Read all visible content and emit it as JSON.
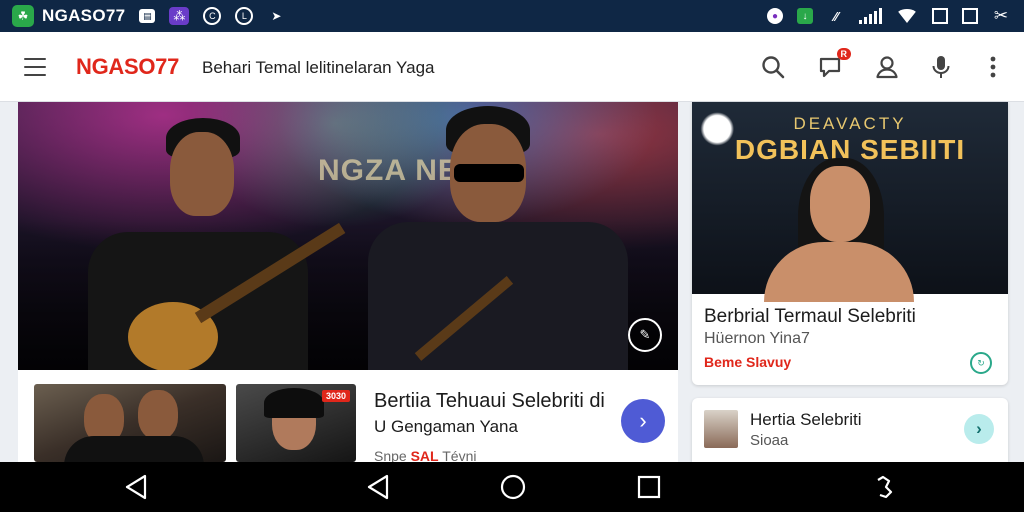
{
  "status_bar": {
    "app_name": "NGASO77",
    "left_icons": [
      "app-logo-icon",
      "keyboard-icon",
      "podcast-icon",
      "vpn-icon",
      "data-saver-icon",
      "arrow-icon"
    ],
    "right_icons": [
      "location-icon",
      "download-icon",
      "hd-icon",
      "signal-icon",
      "wifi-icon",
      "square-icon",
      "square-icon",
      "settings-icon"
    ]
  },
  "app_bar": {
    "brand": "NGASO77",
    "tagline": "Behari Temal lelitinelaran Yaga",
    "actions": [
      "search-icon",
      "notification-icon",
      "account-icon",
      "mic-icon",
      "more-vert-icon"
    ],
    "notification_badge": "R"
  },
  "main_article": {
    "hero_overlay_text": "NGZA NEI",
    "title": "Bertiia Tehuaui Selebriti di",
    "subtitle": "U Gengaman Yana",
    "meta_prefix": "Snpe",
    "meta_highlight": "SAL",
    "meta_suffix": "Tévni",
    "thumb_badge": "3030"
  },
  "side_card_1": {
    "kicker": "DEAVACTY",
    "headline": "DGBIAN SEBIITI",
    "title": "Berbrial Termaul Selebriti",
    "subtitle": "Hüernon Yina7",
    "meta": "Beme Slavuy"
  },
  "side_card_2": {
    "title": "Hertia Selebriti",
    "subtitle": "Sioaa"
  },
  "nav_bar": {
    "buttons": [
      "back-icon",
      "home-icon",
      "recents-icon"
    ]
  },
  "colors": {
    "accent_red": "#e0271b",
    "status_bar": "#0f2745",
    "fab_blue": "#4f5bd5",
    "teal": "#2aa88a"
  }
}
